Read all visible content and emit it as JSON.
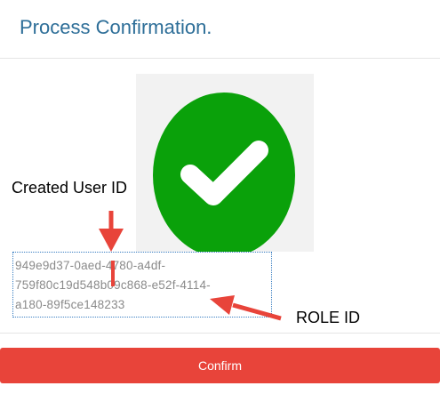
{
  "dialog": {
    "title": "Process Confirmation."
  },
  "status_icon": {
    "icon": "check-circle-icon",
    "color": "#0aa10a"
  },
  "annotations": {
    "created_user_id_label": "Created User ID",
    "role_id_label": "ROLE  ID",
    "arrow_color": "#e8443a"
  },
  "result": {
    "id_lines": [
      "949e9d37-0aed-4780-a4df-",
      "759f80c19d548b09c868-e52f-4114-",
      "a180-89f5ce148233"
    ]
  },
  "footer": {
    "confirm_label": "Confirm",
    "confirm_color": "#e8443a"
  }
}
